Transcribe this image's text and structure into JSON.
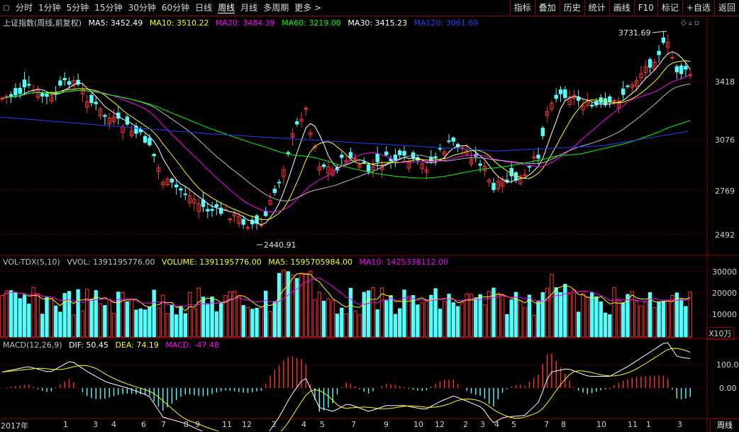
{
  "toolbar": {
    "periods": [
      "分时",
      "1分钟",
      "5分钟",
      "15分钟",
      "30分钟",
      "60分钟",
      "日线",
      "周线",
      "月线",
      "多周期",
      "更多 >"
    ],
    "active_period": "周线",
    "right_buttons": [
      "指标",
      "叠加",
      "历史",
      "统计",
      "画线",
      "F10",
      "标记",
      "+自选",
      "返回"
    ]
  },
  "price_panel": {
    "title": "上证指数(周线,前复权)",
    "ma": [
      {
        "label": "MA5: 3452.49",
        "color": "#ffffff"
      },
      {
        "label": "MA10: 3510.22",
        "color": "#ffff00"
      },
      {
        "label": "MA20: 3484.39",
        "color": "#ff00ff"
      },
      {
        "label": "MA60: 3219.00",
        "color": "#00ff00"
      },
      {
        "label": "MA30: 3415.23",
        "color": "#ffffff"
      },
      {
        "label": "MA120: 3061.69",
        "color": "#2040ff"
      }
    ],
    "y_ticks": [
      "3418",
      "3076",
      "2769",
      "2492"
    ],
    "high_label": "3731.69",
    "low_label": "2440.91"
  },
  "volume_panel": {
    "labels": [
      {
        "text": "VOL-TDX(5,10)",
        "color": "#c0c0c0"
      },
      {
        "text": "VVOL: 1391195776.00",
        "color": "#c0c0c0"
      },
      {
        "text": "VOLUME: 1391195776.00",
        "color": "#ffff00"
      },
      {
        "text": "MA5: 1595705984.00",
        "color": "#ffff00"
      },
      {
        "text": "MA10: 1425338112.00",
        "color": "#ff00ff"
      }
    ],
    "y_ticks": [
      "30000",
      "20000",
      "10000"
    ],
    "unit": "X10万"
  },
  "macd_panel": {
    "labels": [
      {
        "text": "MACD(12,26,9)",
        "color": "#c0c0c0"
      },
      {
        "text": "DIF: 50.45",
        "color": "#ffffff"
      },
      {
        "text": "DEA: 74.19",
        "color": "#ffff00"
      },
      {
        "text": "MACD: -47.48",
        "color": "#ff00ff"
      }
    ],
    "y_ticks": [
      "100.0",
      "0.00"
    ]
  },
  "x_axis": [
    "2017年",
    "1",
    "3",
    "4",
    "6",
    "7",
    "8",
    "9",
    "11",
    "12",
    "2",
    "4",
    "5",
    "7",
    "9",
    "10",
    "12",
    "2",
    "3",
    "4",
    "5",
    "7",
    "8",
    "10",
    "11",
    "1",
    "3"
  ],
  "bottom_right": "周线",
  "colors": {
    "up": "#ff3232",
    "down": "#54ffff",
    "grid": "#8b0000"
  }
}
